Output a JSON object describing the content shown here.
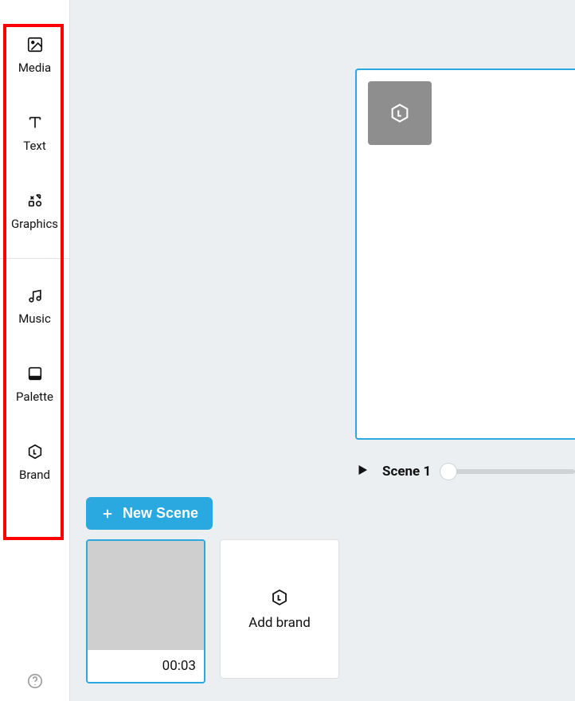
{
  "sidebar": {
    "items": [
      {
        "label": "Media"
      },
      {
        "label": "Text"
      },
      {
        "label": "Graphics"
      },
      {
        "label": "Music"
      },
      {
        "label": "Palette"
      },
      {
        "label": "Brand"
      }
    ]
  },
  "player": {
    "scene_label": "Scene 1"
  },
  "new_scene_label": "New Scene",
  "scene_card": {
    "timestamp": "00:03"
  },
  "add_brand_label": "Add brand"
}
